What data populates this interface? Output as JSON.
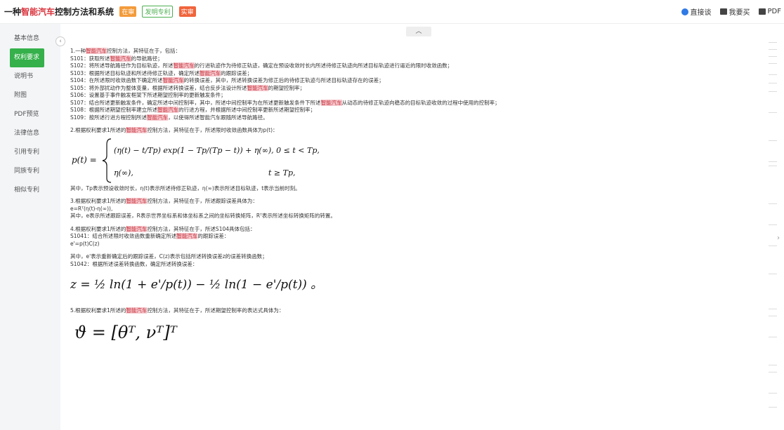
{
  "header": {
    "title_pre": "一种",
    "title_highlight": "智能汽车",
    "title_post": "控制方法和系统",
    "badges": [
      "在审",
      "发明专利",
      "实审"
    ],
    "actions": {
      "chat": "直接谈",
      "buy": "我要买",
      "pdf": "PDF"
    }
  },
  "sidebar": {
    "items": [
      {
        "label": "基本信息"
      },
      {
        "label": "权利要求"
      },
      {
        "label": "说明书"
      },
      {
        "label": "附图"
      },
      {
        "label": "PDF预览"
      },
      {
        "label": "法律信息"
      },
      {
        "label": "引用专利"
      },
      {
        "label": "同族专利"
      },
      {
        "label": "相似专利"
      }
    ],
    "active_index": 1,
    "collapse_icon": "chevron-left-icon"
  },
  "content": {
    "scroll_up_icon": "chevron-up-icon",
    "claim1_lines": [
      [
        "1.一种",
        "智能汽车",
        "控制方法，其特征在于，包括："
      ],
      [
        "S101：获取所述",
        "智能汽车",
        "的导航路径；"
      ],
      [
        "S102：将所述导航路径作为目标轨迹，所述",
        "智能汽车",
        "的行进轨迹作为待修正轨迹，确定在预设收敛时长内所述待修正轨迹向所述目标轨迹进行逼近的限时收敛函数；"
      ],
      [
        "S103：根据所述目标轨迹和所述待修正轨迹，确定所述",
        "智能汽车",
        "的跟踪误差；"
      ],
      [
        "S104：在所述限时收敛函数下确定所述",
        "智能汽车",
        "的转换误差，其中，所述转换误差为修正后的待修正轨迹与所述目标轨迹存在的误差；"
      ],
      [
        "S105：将外部扰动作为整体变量，根据所述转换误差，结合反步法设计所述",
        "智能汽车",
        "的期望控制率；"
      ],
      [
        "S106：设置基于事件触发框架下所述期望控制率的更新触发条件；",
        "",
        ""
      ],
      [
        "S107：结合所述更新触发条件，确定所述中间控制率，其中，所述中间控制率为在所述更新触发条件下所述",
        "智能汽车",
        "从动态的待修正轨迹向稳态的目标轨迹收敛的过程中使用的控制率；"
      ],
      [
        "S108：根据所述期望控制率建立所述",
        "智能汽车",
        "的行进方程，并根据所述中间控制率更新所述期望控制率；"
      ],
      [
        "S109：按所述行进方程控制所述",
        "智能汽车",
        "，以使得所述智能汽车跟随所述导航路径。"
      ]
    ],
    "claim2_head": [
      "2.根据权利要求1所述的",
      "智能汽车",
      "控制方法，其特征在于，所述限时收敛函数具体为p(t)："
    ],
    "claim2_formula": {
      "lhs": "p(t) =",
      "row1": "(η(t) − t/Tp) exp(1 − Tp/(Tp − t)) + η(∞), 0 ≤ t < Tp,",
      "row2a": "η(∞),",
      "row2b": "t ≥ Tp,"
    },
    "claim2_note": "其中，Tp表示预设收敛时长，η(t)表示所述待修正轨迹，η(∞)表示所述目标轨迹，t表示当前时刻。",
    "claim3_head": [
      "3.根据权利要求1所述的",
      "智能汽车",
      "控制方法，其特征在于，所述跟踪误差具体为："
    ],
    "claim3_eq": "e=Rᵀ(η(t)-η(∞)),",
    "claim3_note": "其中，e表示所述跟踪误差，R表示世界坐标系和体坐标系之间的坐标转换矩阵，Rᵀ表示所述坐标转换矩阵的转置。",
    "claim4_head": [
      "4.根据权利要求1所述的",
      "智能汽车",
      "控制方法，其特征在于，所述S104具体包括："
    ],
    "claim4_s1041": [
      "S1041：结合所述限时收敛函数重新确定所述",
      "智能汽车",
      "的跟踪误差："
    ],
    "claim4_eq": "e'=p(t)C(z)",
    "claim4_note": "其中，e'表示重新确定后的跟踪误差，C(z)表示包括所述转换误差z的误差转换函数；",
    "claim4_s1042": "S1042：根据所述误差转换函数，确定所述转换误差：",
    "claim4_formula": "z = ½ ln(1 + e'/p(t)) − ½ ln(1 − e'/p(t)) 。",
    "claim5_head": [
      "5.根据权利要求1所述的",
      "智能汽车",
      "控制方法，其特征在于，所述期望控制率的表达式具体为："
    ],
    "claim5_formula": "ϑ = [θᵀ, νᵀ]ᵀ",
    "right_arrow_icon": "chevron-right-icon"
  }
}
